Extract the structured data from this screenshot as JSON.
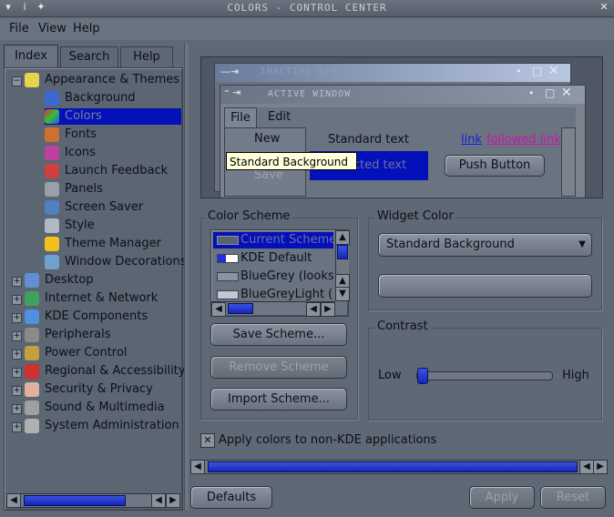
{
  "window": {
    "title": "COLORS - CONTROL CENTER"
  },
  "menubar": {
    "file": "File",
    "view": "View",
    "help": "Help"
  },
  "tabs": {
    "index": "Index",
    "search": "Search",
    "help": "Help"
  },
  "tree": {
    "appearance": "Appearance & Themes",
    "children": [
      "Background",
      "Colors",
      "Fonts",
      "Icons",
      "Launch Feedback",
      "Panels",
      "Screen Saver",
      "Style",
      "Theme Manager",
      "Window Decorations"
    ],
    "top": [
      "Desktop",
      "Internet & Network",
      "KDE Components",
      "Peripherals",
      "Power Control",
      "Regional & Accessibility",
      "Security & Privacy",
      "Sound & Multimedia",
      "System Administration"
    ]
  },
  "preview": {
    "inactive_title": "INACTIVE WINDOW",
    "active_title": "ACTIVE WINDOW",
    "menu_file": "File",
    "menu_edit": "Edit",
    "menu_new": "New",
    "menu_save": "Save",
    "standard_text": "Standard text",
    "link": "link",
    "followed_link": "followed link",
    "selected_text": "Selected text",
    "push_button": "Push Button",
    "tooltip": "Standard Background"
  },
  "color_scheme": {
    "title": "Color Scheme",
    "items": [
      "Current Scheme",
      "KDE Default",
      "BlueGrey (looks",
      "BlueGreyLight (lo"
    ],
    "save": "Save Scheme...",
    "remove": "Remove Scheme",
    "import": "Import Scheme..."
  },
  "widget_color": {
    "title": "Widget Color",
    "selected": "Standard Background"
  },
  "contrast": {
    "title": "Contrast",
    "low": "Low",
    "high": "High",
    "level": 0.0
  },
  "apply_non_kde": {
    "label": "Apply colors to non-KDE applications",
    "checked": true
  },
  "buttons": {
    "defaults": "Defaults",
    "apply": "Apply",
    "reset": "Reset"
  },
  "colors": {
    "selection": "#0410b8",
    "thumb": "#2035d0",
    "tooltip_bg": "#ffffdc",
    "link": "#1020e0",
    "followed": "#d010b0"
  }
}
